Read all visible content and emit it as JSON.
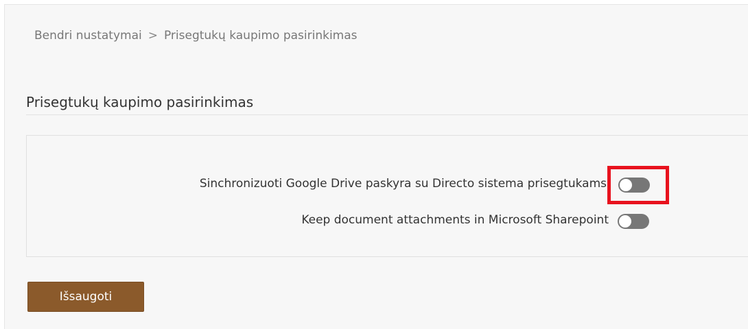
{
  "breadcrumb": {
    "parent": "Bendri nustatymai",
    "separator": ">",
    "current": "Prisegtukų kaupimo pasirinkimas"
  },
  "section": {
    "title": "Prisegtukų kaupimo pasirinkimas"
  },
  "settings": [
    {
      "label": "Sinchronizuoti Google Drive paskyra su Directo sistema prisegtukams",
      "enabled": false
    },
    {
      "label": "Keep document attachments in Microsoft Sharepoint",
      "enabled": false
    }
  ],
  "actions": {
    "save_label": "Išsaugoti"
  },
  "colors": {
    "save_button": "#8b5a2b",
    "toggle_off": "#777777",
    "highlight": "#e8121e"
  }
}
